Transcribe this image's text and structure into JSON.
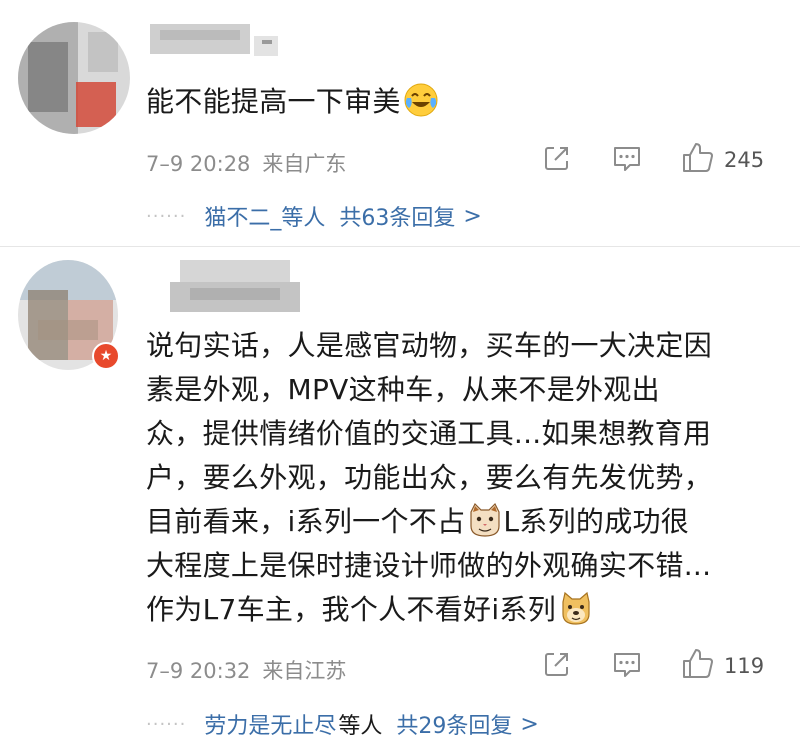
{
  "comments": [
    {
      "text_lines": [
        "能不能提高一下审美"
      ],
      "emoji": [
        "laughing-crying-emoji"
      ],
      "time": "7–9 20:28",
      "location": "来自广东",
      "likes": "245",
      "replies": {
        "names": "猫不二_等人",
        "count_text": "共63条回复"
      }
    },
    {
      "text_lines": [
        "说句实话，人是感官动物，买车的一大决定因",
        "素是外观，MPV这种车，从来不是外观出",
        "众，提供情绪价值的交通工具...如果想教育用",
        "户，要么外观，功能出众，要么有先发优势，",
        "目前看来，i系列一个不占",
        "L系列的成功很",
        "大程度上是保时捷设计师做的外观确实不错...",
        "作为L7车主，我个人不看好i系列"
      ],
      "emoji": [
        "cat-emoji",
        "doge-emoji"
      ],
      "time": "7–9 20:32",
      "location": "来自江苏",
      "likes": "119",
      "replies": {
        "names": "劳力是无止尽",
        "names_suffix": "等人",
        "count_text": "共29条回复"
      }
    }
  ],
  "colors": {
    "link": "#3b6ea8",
    "meta": "#8c8c8c",
    "verified_badge": "#e8492c"
  },
  "icons": [
    "share-icon",
    "comment-icon",
    "thumbs-up-icon",
    "chevron-right-icon"
  ]
}
